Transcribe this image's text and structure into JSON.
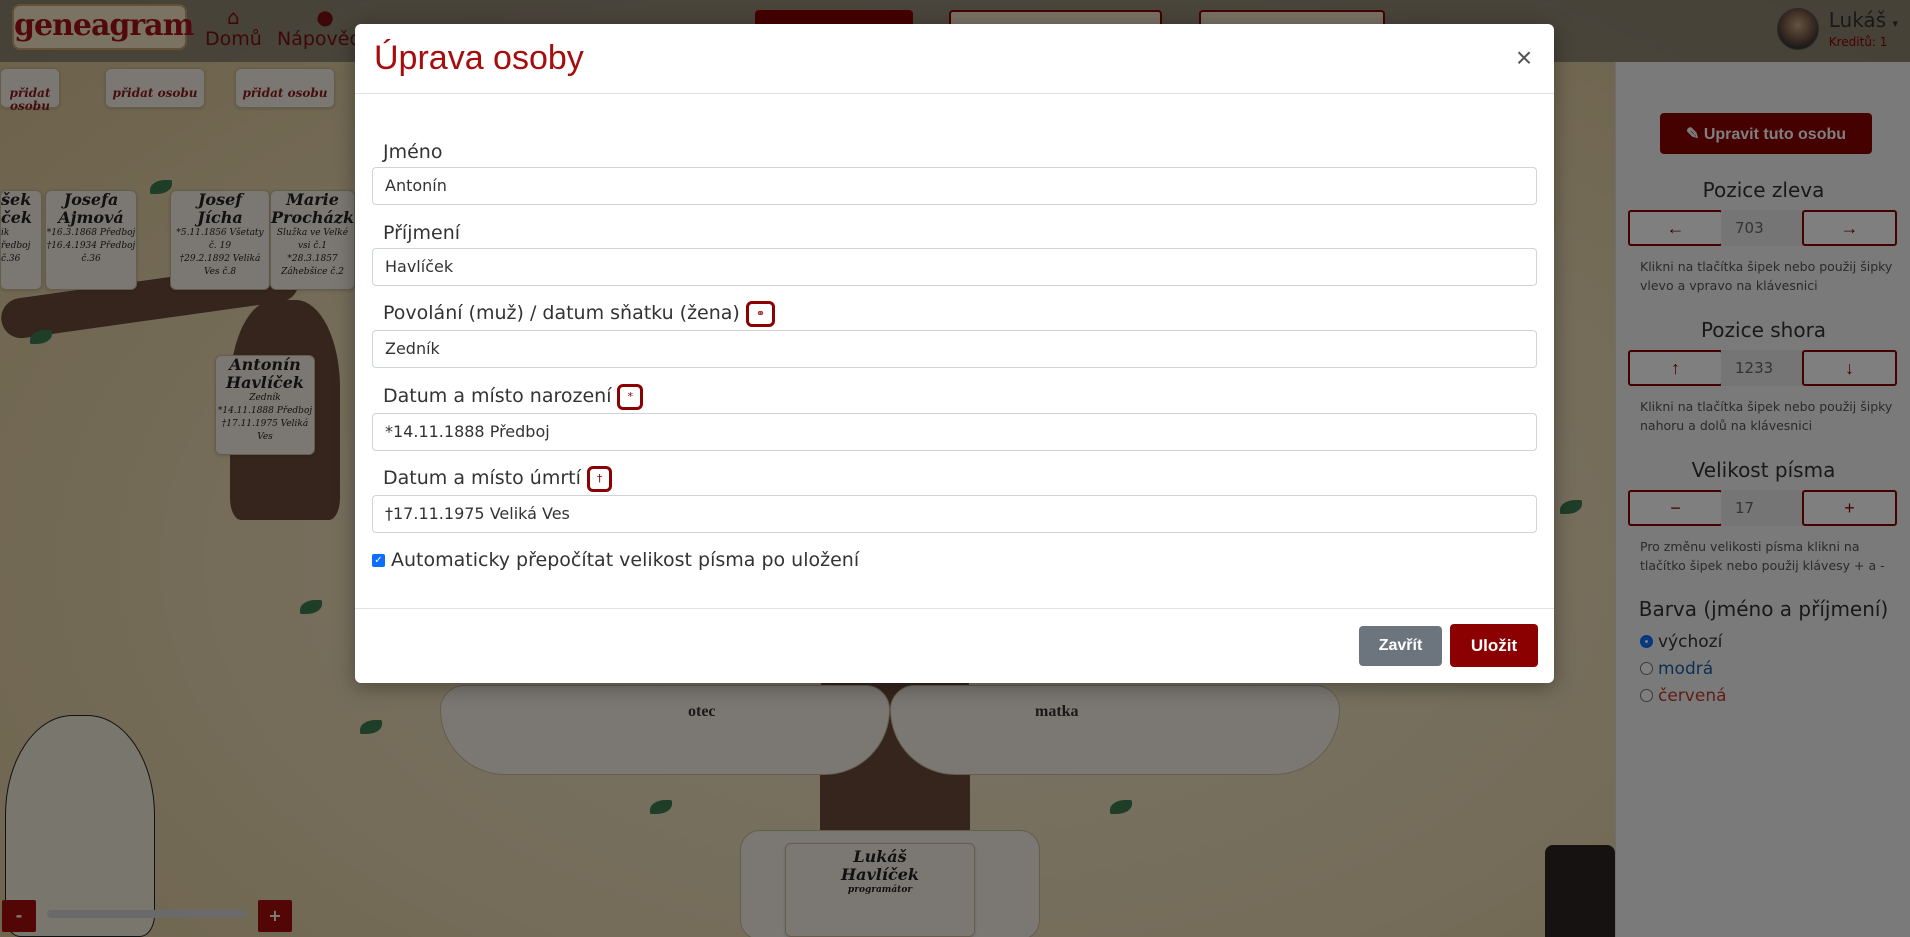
{
  "navbar": {
    "logo": "geneagram",
    "home_label": "Domů",
    "help_label": "Nápověda",
    "user_name": "Lukáš",
    "user_credits": "Kreditů: 1"
  },
  "background": {
    "add_person_label": "přidat osobu",
    "cards": [
      {
        "name": "šek\nček",
        "line1": "ik",
        "line2": "ředboj č.36"
      },
      {
        "name": "Josefa\nAjmová",
        "line1": "*16.3.1868 Předboj",
        "line2": "†16.4.1934 Předboj č.36"
      },
      {
        "name": "Josef\nJícha",
        "line1": "*5.11.1856 Všetaty č. 19",
        "line2": "†29.2.1892 Veliká Ves č.8"
      },
      {
        "name": "Marie\nProcházková",
        "line1": "Služka ve Velké vsi č.1",
        "line2": "*28.3.1857 Záhebšice č.2"
      },
      {
        "name": "Antonín\nHavlíček",
        "line1": "Zedník",
        "line2": "*14.11.1888 Předboj",
        "line3": "†17.11.1975 Veliká Ves"
      },
      {
        "name": "Lukáš\nHavlíček",
        "line1": "programátor"
      }
    ],
    "father_label": "otec",
    "mother_label": "matka"
  },
  "modal": {
    "title": "Úprava osoby",
    "close_icon": "×",
    "fields": [
      {
        "label": "Jméno",
        "value": "Antonín"
      },
      {
        "label": "Příjmení",
        "value": "Havlíček"
      },
      {
        "label": "Povolání (muž) / datum sňatku (žena)",
        "badge": "⚭",
        "value": "Zedník"
      },
      {
        "label": "Datum a místo narození",
        "badge": "*",
        "value": "*14.11.1888 Předboj"
      },
      {
        "label": "Datum a místo úmrtí",
        "badge": "†",
        "value": "†17.11.1975 Veliká Ves"
      }
    ],
    "auto_resize_label": "Automaticky přepočítat velikost písma po uložení",
    "auto_resize_checked": true,
    "close_button": "Zavřít",
    "save_button": "Uložit"
  },
  "sidebar": {
    "edit_button": "Upravit tuto osobu",
    "left_title": "Pozice zleva",
    "left_value": "703",
    "left_hint": "Klikni na tlačítka šipek nebo použij šipky vlevo a vpravo na klávesnici",
    "top_title": "Pozice shora",
    "top_value": "1233",
    "top_hint": "Klikni na tlačítka šipek nebo použij šipky nahoru a dolů na klávesnici",
    "font_title": "Velikost písma",
    "font_value": "17",
    "font_hint": "Pro změnu velikosti písma klikni na tlačítko šipek nebo použij klávesy + a -",
    "color_title": "Barva (jméno a příjmení)",
    "colors": [
      {
        "label": "výchozí",
        "hex": "#333333",
        "selected": true
      },
      {
        "label": "modrá",
        "hex": "#1a5fa8",
        "selected": false
      },
      {
        "label": "červená",
        "hex": "#c0392b",
        "selected": false
      }
    ]
  },
  "zoom": {
    "minus": "-",
    "plus": "+"
  }
}
